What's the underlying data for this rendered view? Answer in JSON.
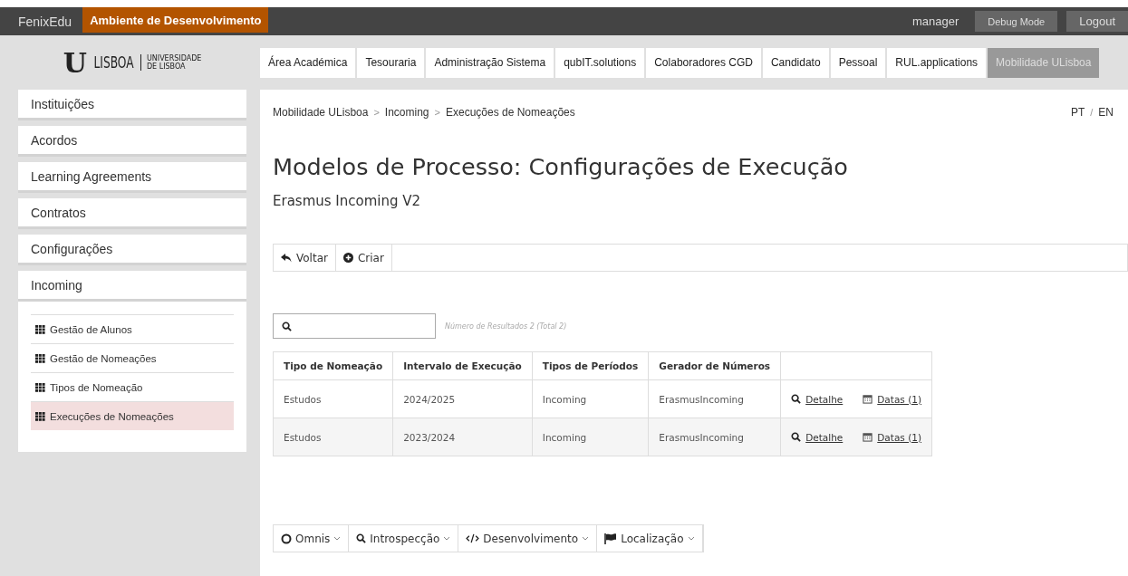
{
  "top_bar": {
    "brand": "FenixEdu",
    "environment": "Ambiente de Desenvolvimento",
    "user": "manager",
    "buttons": [
      "Debug Mode",
      "Logout"
    ]
  },
  "logo": {
    "mark": "U",
    "name": "LISBOA",
    "subtitle_lines": [
      "UNIVERSIDADE",
      "DE LISBOA"
    ]
  },
  "nav_tabs": [
    {
      "label": "Área Académica",
      "selected": false
    },
    {
      "label": "Tesouraria",
      "selected": false
    },
    {
      "label": "Administração Sistema",
      "selected": false
    },
    {
      "label": "qubIT.solutions",
      "selected": false
    },
    {
      "label": "Colaboradores CGD",
      "selected": false
    },
    {
      "label": "Candidato",
      "selected": false
    },
    {
      "label": "Pessoal",
      "selected": false
    },
    {
      "label": "RUL.applications",
      "selected": false
    },
    {
      "label": "Mobilidade ULisboa",
      "selected": true
    }
  ],
  "sidebar": {
    "items": [
      {
        "label": "Instituições",
        "expanded": false
      },
      {
        "label": "Acordos",
        "expanded": false
      },
      {
        "label": "Learning Agreements",
        "expanded": false
      },
      {
        "label": "Contratos",
        "expanded": false
      },
      {
        "label": "Configurações",
        "expanded": false
      },
      {
        "label": "Incoming",
        "expanded": true,
        "children": [
          {
            "label": "Gestão de Alunos",
            "selected": false
          },
          {
            "label": "Gestão de Nomeações",
            "selected": false
          },
          {
            "label": "Tipos de Nomeação",
            "selected": false
          },
          {
            "label": "Execuções de Nomeações",
            "selected": true
          }
        ]
      }
    ]
  },
  "breadcrumb": [
    "Mobilidade ULisboa",
    "Incoming",
    "Execuções de Nomeações"
  ],
  "breadcrumb_separator": ">",
  "languages": {
    "options": [
      "PT",
      "EN"
    ],
    "separator": "/"
  },
  "title": "Modelos de Processo: Configurações de Execução",
  "subtitle": "Erasmus Incoming V2",
  "toolbar": [
    {
      "kind": "back",
      "label": "Voltar"
    },
    {
      "kind": "create",
      "label": "Criar"
    }
  ],
  "search": {
    "results_text": "Número de Resultados 2 (Total 2)"
  },
  "table": {
    "columns": [
      "Tipo de Nomeação",
      "Intervalo de Execução",
      "Tipos de Períodos",
      "Gerador de Números"
    ],
    "rows": [
      {
        "cells": [
          "Estudos",
          "2024/2025",
          "Incoming",
          "ErasmusIncoming"
        ],
        "actions": [
          "Detalhe",
          "Datas (1)"
        ]
      },
      {
        "cells": [
          "Estudos",
          "2023/2024",
          "Incoming",
          "ErasmusIncoming"
        ],
        "actions": [
          "Detalhe",
          "Datas (1)"
        ]
      }
    ]
  },
  "dev_menu": [
    {
      "kind": "omnis",
      "label": "Omnis"
    },
    {
      "kind": "introspection",
      "label": "Introspecção"
    },
    {
      "kind": "code",
      "label": "Desenvolvimento"
    },
    {
      "kind": "flag",
      "label": "Localização"
    }
  ]
}
